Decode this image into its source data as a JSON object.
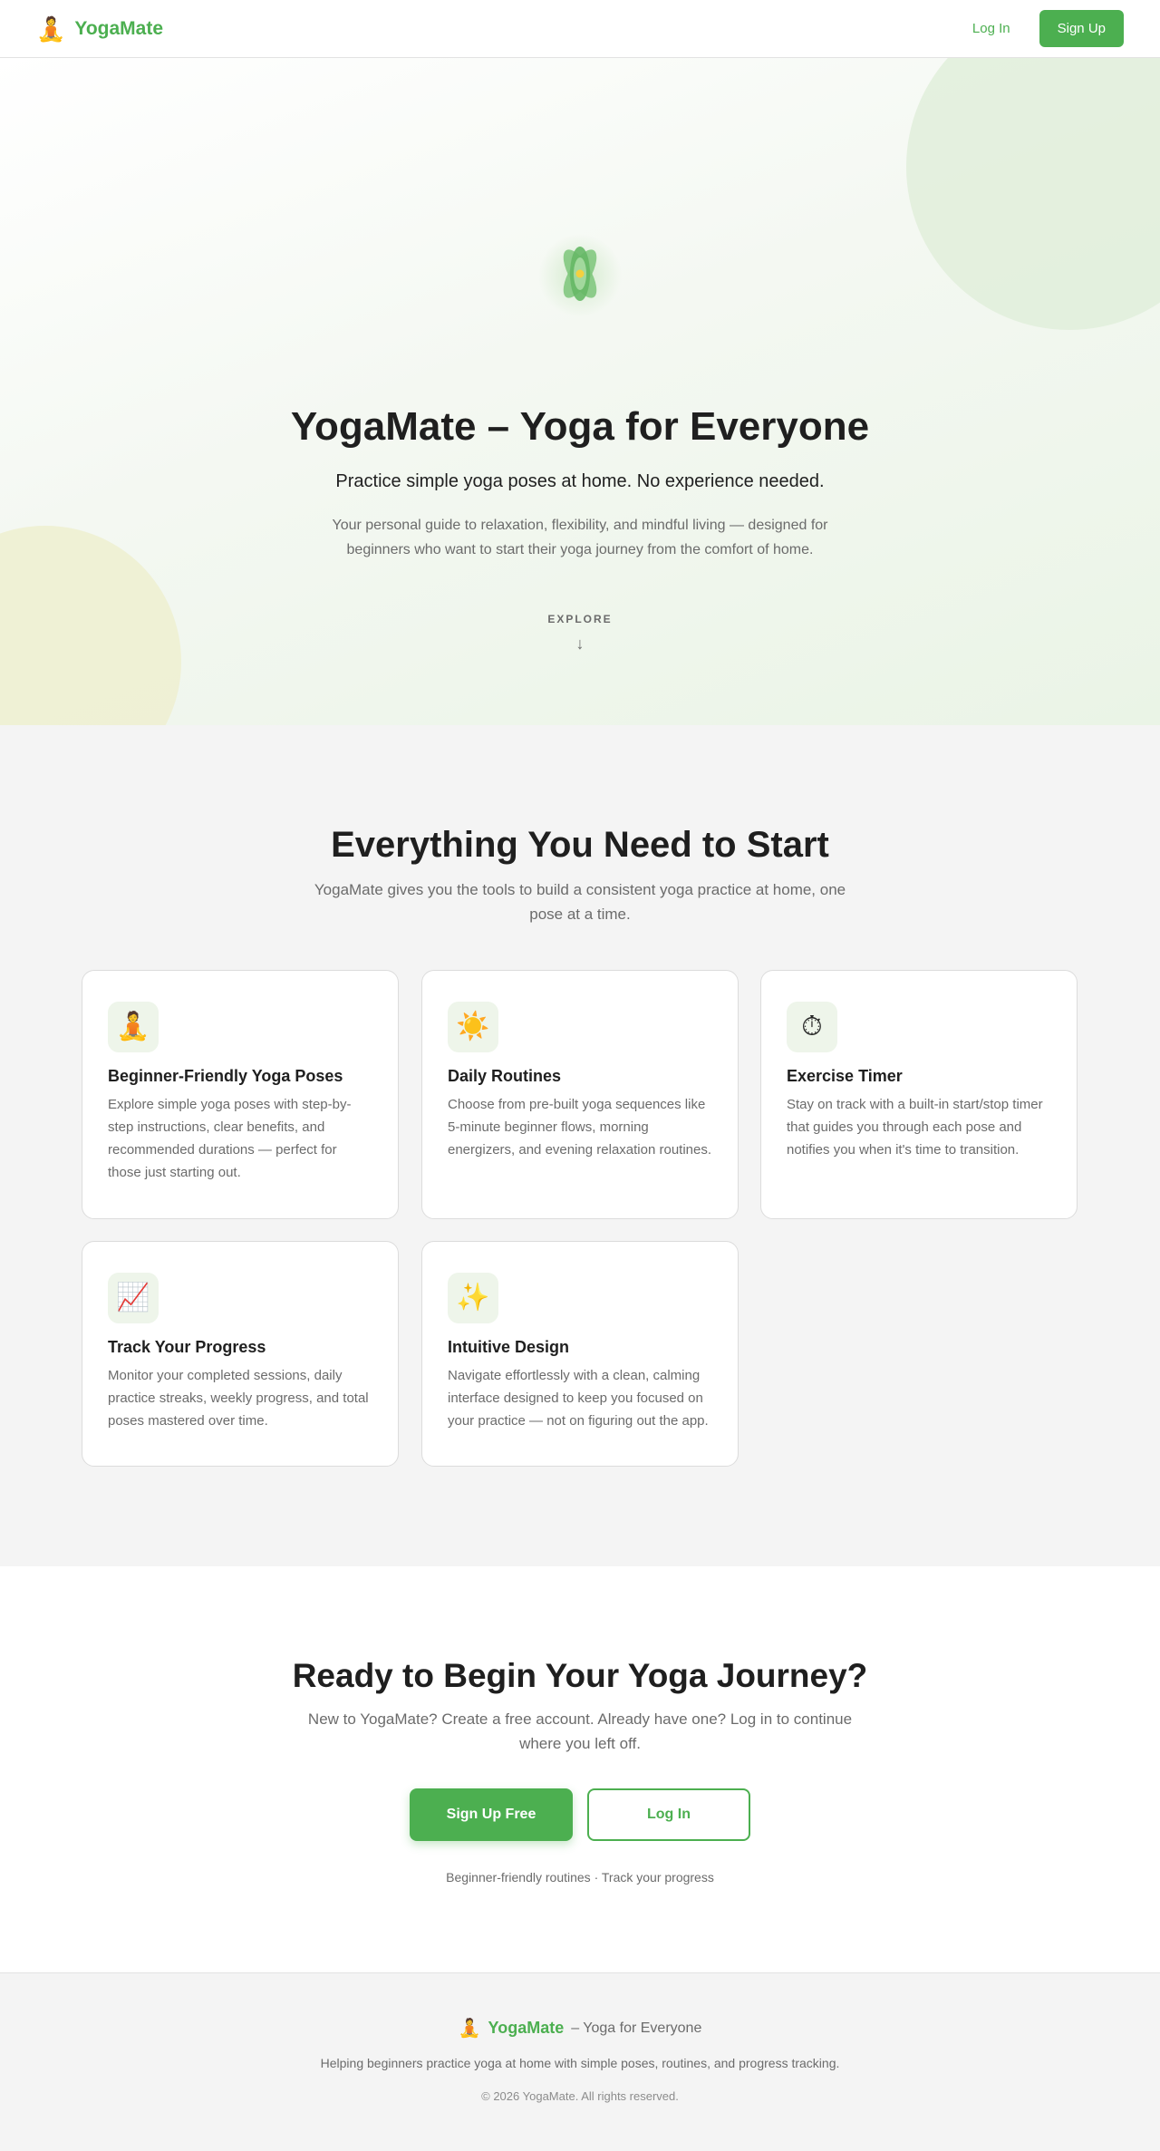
{
  "header": {
    "logo_icon": "🧘",
    "logo_text": "YogaMate",
    "login_label": "Log In",
    "signup_label": "Sign Up"
  },
  "hero": {
    "icon": "lotus-icon",
    "title": "YogaMate – Yoga for Everyone",
    "subtitle": "Practice simple yoga poses at home. No experience needed.",
    "description": "Your personal guide to relaxation, flexibility, and mindful living — designed for beginners who want to start their yoga journey from the comfort of home.",
    "explore_label": "EXPLORE",
    "explore_arrow": "↓"
  },
  "features": {
    "title": "Everything You Need to Start",
    "description": "YogaMate gives you the tools to build a consistent yoga practice at home, one pose at a time.",
    "cards": [
      {
        "icon": "🧘",
        "title": "Beginner-Friendly Yoga Poses",
        "text": "Explore simple yoga poses with step-by-step instructions, clear benefits, and recommended durations — perfect for those just starting out."
      },
      {
        "icon": "☀️",
        "title": "Daily Routines",
        "text": "Choose from pre-built yoga sequences like 5-minute beginner flows, morning energizers, and evening relaxation routines."
      },
      {
        "icon": "⏱",
        "title": "Exercise Timer",
        "text": "Stay on track with a built-in start/stop timer that guides you through each pose and notifies you when it's time to transition."
      },
      {
        "icon": "📈",
        "title": "Track Your Progress",
        "text": "Monitor your completed sessions, daily practice streaks, weekly progress, and total poses mastered over time."
      },
      {
        "icon": "✨",
        "title": "Intuitive Design",
        "text": "Navigate effortlessly with a clean, calming interface designed to keep you focused on your practice — not on figuring out the app."
      }
    ]
  },
  "cta": {
    "title": "Ready to Begin Your Yoga Journey?",
    "description": "New to YogaMate? Create a free account. Already have one? Log in to continue where you left off.",
    "signup_label": "Sign Up Free",
    "login_label": "Log In",
    "note": "Beginner-friendly routines · Track your progress"
  },
  "footer": {
    "logo_icon": "🧘",
    "logo_text": "YogaMate",
    "tagline": "– Yoga for Everyone",
    "description": "Helping beginners practice yoga at home with simple poses, routines, and progress tracking.",
    "copyright": "© 2026 YogaMate. All rights reserved."
  },
  "colors": {
    "brand_green": "#4caf50",
    "text_dark": "#1f1f1f",
    "text_muted": "#6b6b6b",
    "section_gray": "#f4f4f4"
  }
}
